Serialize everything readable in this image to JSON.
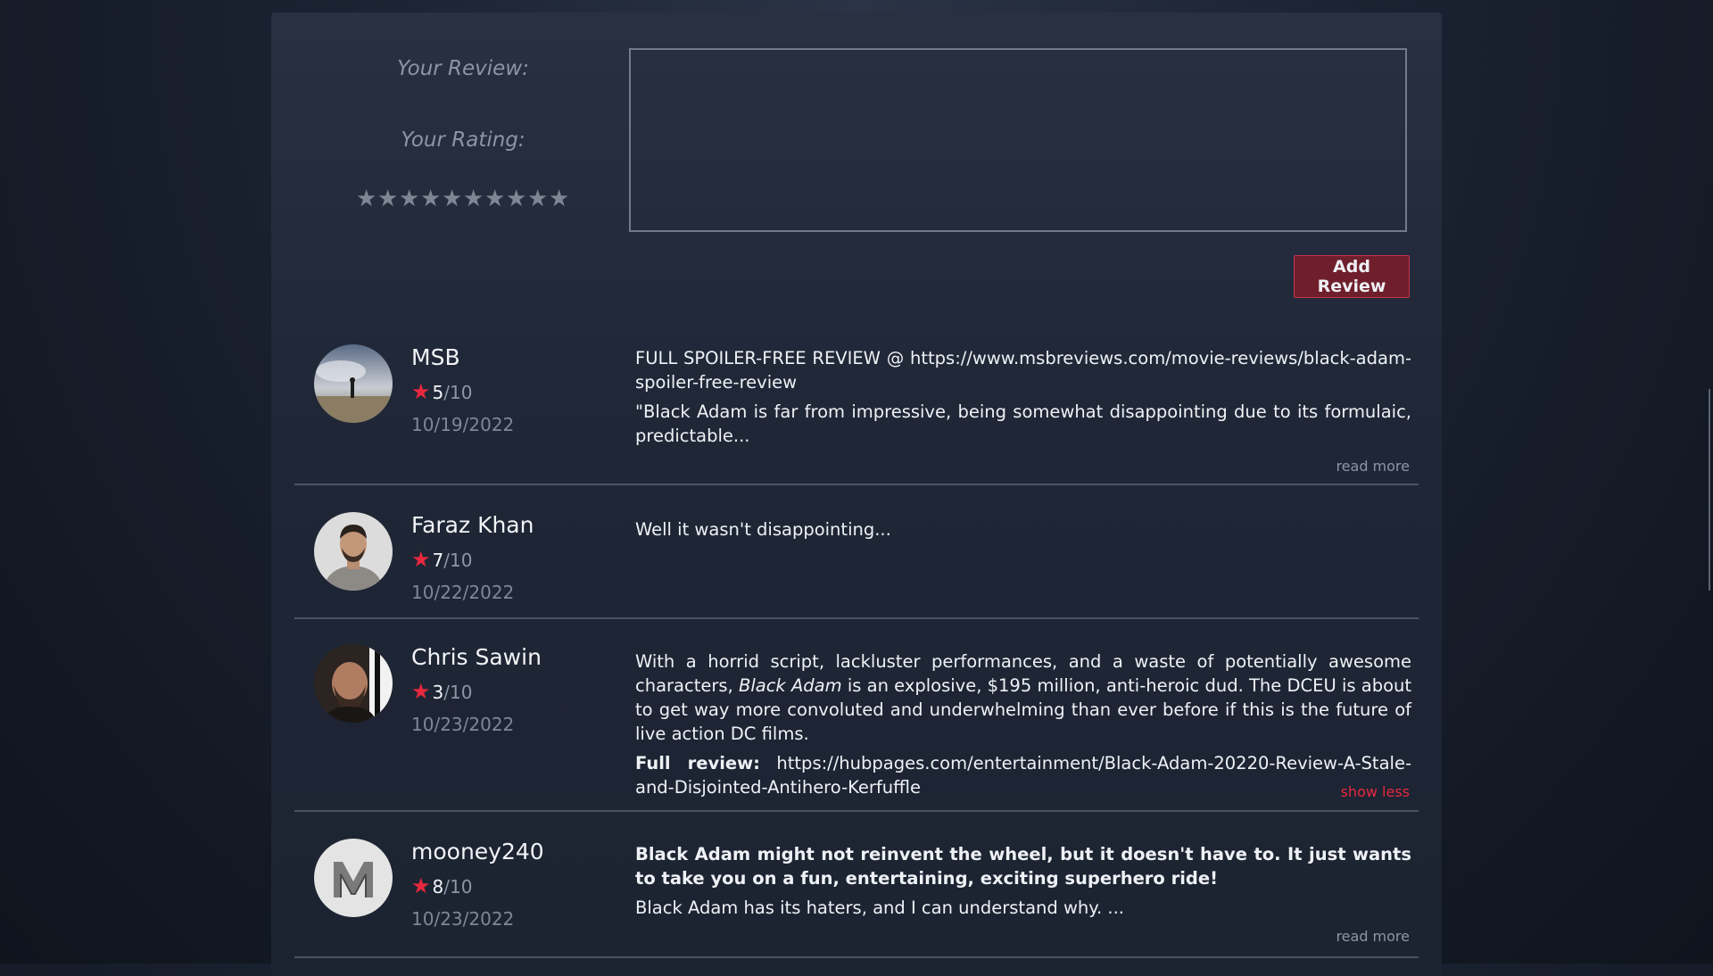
{
  "form": {
    "review_label": "Your Review:",
    "rating_label": "Your Rating:",
    "star_glyph": "★",
    "max_stars": 10,
    "review_value": "",
    "add_button": "Add Review"
  },
  "colors": {
    "accent": "#e8283e",
    "button_bg": "#6f1f2c"
  },
  "reviews": [
    {
      "name": "MSB",
      "score": "5",
      "out_of": "/10",
      "date": "10/19/2022",
      "paragraphs": [
        "FULL SPOILER-FREE REVIEW @ https://www.msbreviews.com/movie-reviews/black-adam-spoiler-free-review",
        "\"Black Adam is far from impressive, being somewhat disappointing due to its formulaic, predictable..."
      ],
      "toggle": "read more"
    },
    {
      "name": "Faraz Khan",
      "score": "7",
      "out_of": "/10",
      "date": "10/22/2022",
      "paragraphs": [
        "Well it wasn't disappointing..."
      ],
      "toggle": ""
    },
    {
      "name": "Chris Sawin",
      "score": "3",
      "out_of": "/10",
      "date": "10/23/2022",
      "p1_before": "With a horrid script, lackluster performances, and a waste of potentially awesome characters, ",
      "p1_italic": "Black Adam",
      "p1_after": " is an explosive, $195 million, anti-heroic dud. The DCEU is about to get way more convoluted and underwhelming than ever before if this is the future of live action DC films.",
      "p2_bold": "Full review:",
      "p2_text": " https://hubpages.com/entertainment/Black-Adam-20220-Review-A-Stale-and-Disjointed-Antihero-Kerfuffle",
      "toggle": "show less"
    },
    {
      "name": "mooney240",
      "score": "8",
      "out_of": "/10",
      "date": "10/23/2022",
      "p1_bold": "Black Adam might not reinvent the wheel, but it doesn't have to. It just wants to take you on a fun, entertaining, exciting superhero ride!",
      "p2": "Black Adam has its haters, and I can understand why. ...",
      "toggle": "read more"
    }
  ]
}
